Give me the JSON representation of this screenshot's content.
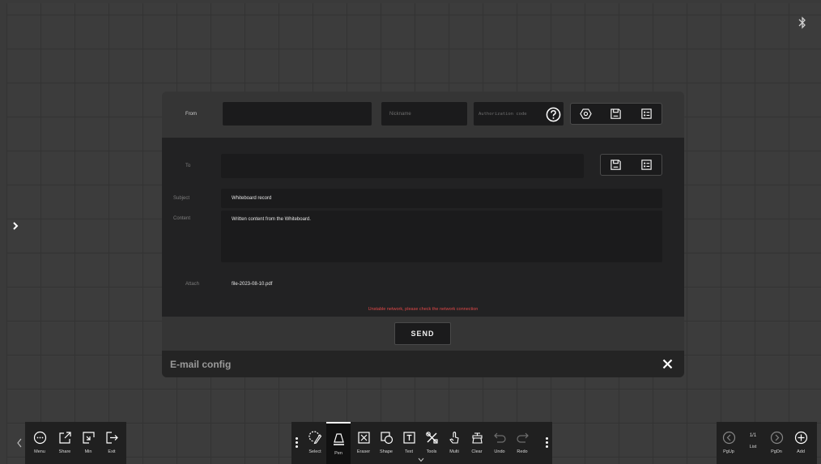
{
  "from": {
    "label": "From",
    "nickname_placeholder": "Nickname",
    "auth_code_placeholder": "Authorization code"
  },
  "to": {
    "label": "To"
  },
  "subject": {
    "label": "Subject",
    "value": "Whiteboard record"
  },
  "content": {
    "label": "Content",
    "value": "Written content from the Whiteboard."
  },
  "attach": {
    "label": "Attach",
    "file": "file-2023-08-10.pdf"
  },
  "error_message": "Unstable network, please check the network connection",
  "send_label": "SEND",
  "dialog_title": "E-mail config",
  "left_toolbar": [
    {
      "label": "Menu",
      "icon": "menu-icon"
    },
    {
      "label": "Share",
      "icon": "share-icon"
    },
    {
      "label": "Min",
      "icon": "minimize-icon"
    },
    {
      "label": "Exit",
      "icon": "exit-icon"
    }
  ],
  "center_toolbar": [
    {
      "label": "Select",
      "icon": "select-icon"
    },
    {
      "label": "Pen",
      "icon": "pen-icon"
    },
    {
      "label": "Eraser",
      "icon": "eraser-icon"
    },
    {
      "label": "Shape",
      "icon": "shape-icon"
    },
    {
      "label": "Text",
      "icon": "text-icon"
    },
    {
      "label": "Tools",
      "icon": "tools-icon"
    },
    {
      "label": "Multi",
      "icon": "multi-touch-icon"
    },
    {
      "label": "Clear",
      "icon": "clear-icon"
    },
    {
      "label": "Undo",
      "icon": "undo-icon"
    },
    {
      "label": "Redo",
      "icon": "redo-icon"
    }
  ],
  "right_toolbar": {
    "pgup_label": "PgUp",
    "page_indicator": "1/1",
    "list_label": "List",
    "pgdn_label": "PgDn",
    "add_label": "Add"
  },
  "colors": {
    "error": "#e04848",
    "panel": "#353535",
    "field": "#1b1b1c"
  }
}
